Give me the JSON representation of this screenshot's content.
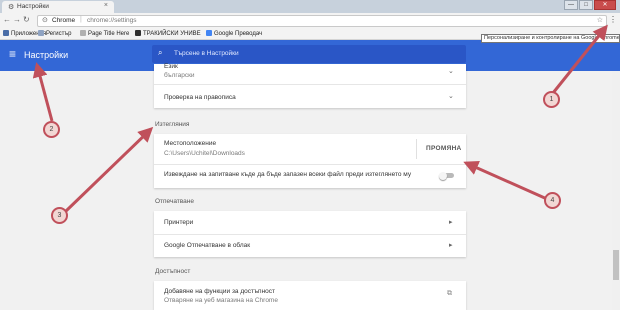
{
  "browser": {
    "tab_title": "Настройки",
    "tab_close": "×",
    "window_controls": [
      "—",
      "□",
      "✕"
    ],
    "omnibox_host": "Chrome",
    "omnibox_path": "chrome://settings",
    "menu_tooltip": "Персонализиране и контролиране на Google Chrome"
  },
  "bookmarks": [
    {
      "label": "Приложения",
      "icon": "apps-grid-icon",
      "color": "#4a6da7"
    },
    {
      "label": "Регистър",
      "icon": "favicon-icon",
      "color": "#8fa3c2"
    },
    {
      "label": "Page Title Here",
      "icon": "page-icon",
      "color": "#b0b0b0"
    },
    {
      "label": "ТРАКИЙСКИ УНИВЕ",
      "icon": "page-icon",
      "color": "#2f2f2f"
    },
    {
      "label": "Google Преводач",
      "icon": "translate-icon",
      "color": "#4285f4"
    }
  ],
  "header": {
    "title": "Настройки",
    "search_placeholder": "Търсене в Настройки",
    "color": "#3367d6"
  },
  "languages_card": {
    "language_title": "Език",
    "language_value": "български",
    "spellcheck": "Проверка на правописа"
  },
  "downloads": {
    "section": "Изтегляния",
    "location_label": "Местоположение",
    "location_path": "C:\\Users\\Uchitel\\Downloads",
    "change_button": "ПРОМЯНА",
    "ask_label": "Извеждане на запитване къде да бъде запазен всеки файл преди изтеглянето му",
    "ask_enabled": false
  },
  "printing": {
    "section": "Отпечатване",
    "printers": "Принтери",
    "cloud_print": "Google Отпечатване в облак"
  },
  "accessibility": {
    "section": "Достъпност",
    "add_title": "Добавяне на функции за достъпност",
    "add_sub": "Отваряне на уеб магазина на Chrome"
  },
  "annotations": [
    "1",
    "2",
    "3",
    "4"
  ],
  "annotation_color": "#c0505b"
}
